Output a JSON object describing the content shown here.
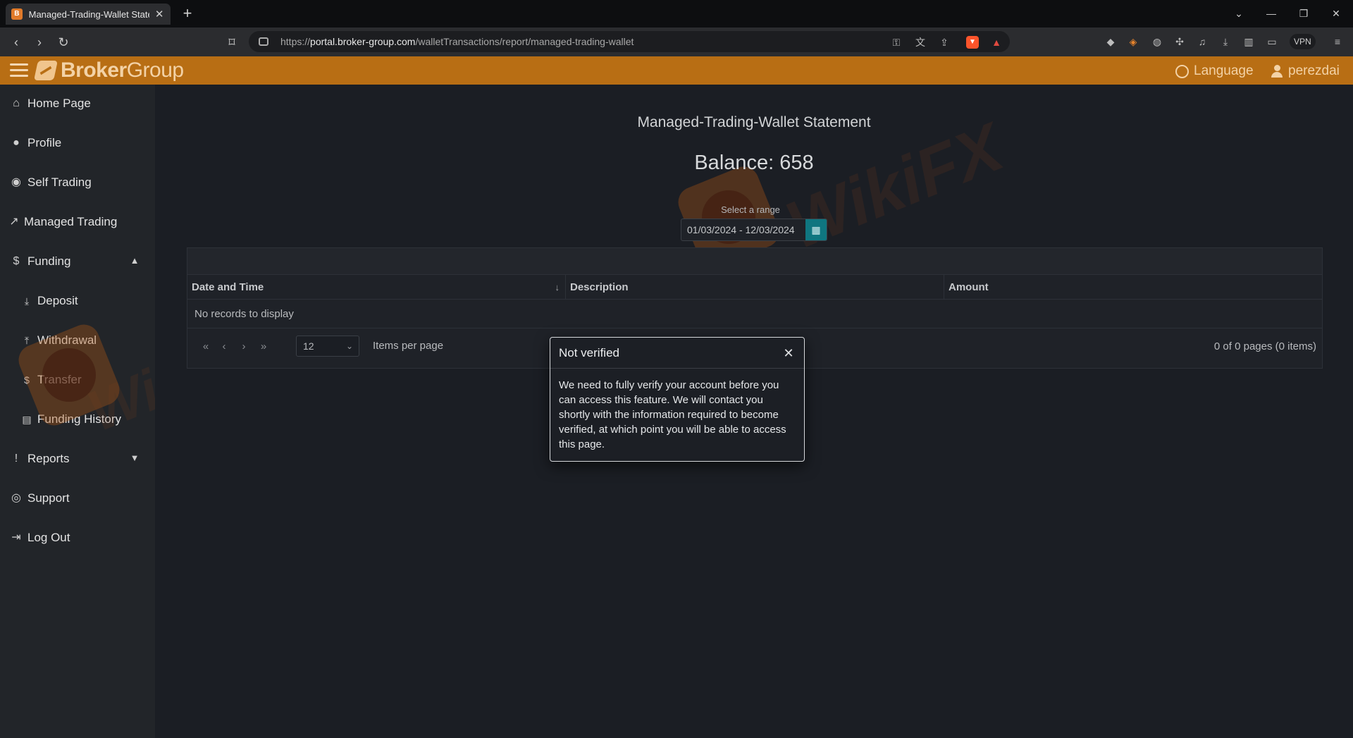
{
  "browser": {
    "tab_title": "Managed-Trading-Wallet Statem",
    "url_host": "portal.broker-group.com",
    "url_path": "/walletTransactions/report/managed-trading-wallet",
    "url_scheme": "https://",
    "vpn_label": "VPN"
  },
  "header": {
    "logo_bold": "Broker",
    "logo_light": "Group",
    "language_label": "Language",
    "username": "perezdai",
    "bar_color": "#b86e14"
  },
  "sidebar": {
    "items": [
      {
        "label": "Home Page",
        "icon": "home-icon"
      },
      {
        "label": "Profile",
        "icon": "user-icon"
      },
      {
        "label": "Self Trading",
        "icon": "brain-icon"
      },
      {
        "label": "Managed Trading",
        "icon": "trend-icon"
      },
      {
        "label": "Funding",
        "icon": "dollar-icon"
      },
      {
        "label": "Deposit",
        "icon": "download-icon"
      },
      {
        "label": "Withdrawal",
        "icon": "upload-icon"
      },
      {
        "label": "Transfer",
        "icon": "transfer-icon"
      },
      {
        "label": "Funding History",
        "icon": "document-icon"
      },
      {
        "label": "Reports",
        "icon": "alert-icon"
      },
      {
        "label": "Support",
        "icon": "lifebuoy-icon"
      },
      {
        "label": "Log Out",
        "icon": "logout-icon"
      }
    ]
  },
  "main": {
    "title": "Managed-Trading-Wallet Statement",
    "balance": "Balance: 658",
    "range_label": "Select a range",
    "range_value": "01/03/2024 - 12/03/2024",
    "grid": {
      "columns": [
        "Date and Time",
        "Description",
        "Amount"
      ],
      "empty_text": "No records to display",
      "page_size": "12",
      "items_per_page_label": "Items per page",
      "pager_info": "0 of 0 pages (0 items)"
    }
  },
  "modal": {
    "title": "Not verified",
    "body": "We need to fully verify your account before you can access this feature. We will contact you shortly with the information required to become verified, at which point you will be able to access this page."
  },
  "watermark": {
    "text": "WikiFX"
  }
}
